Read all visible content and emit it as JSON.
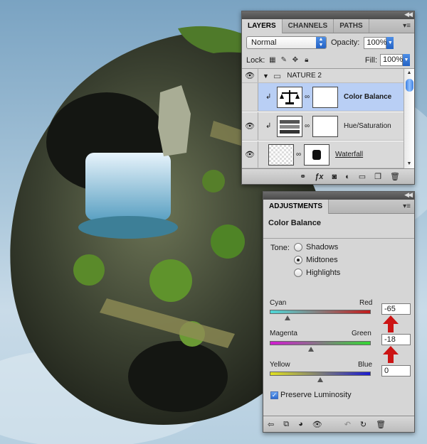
{
  "layers_panel": {
    "tabs": [
      {
        "label": "LAYERS",
        "active": true
      },
      {
        "label": "CHANNELS",
        "active": false
      },
      {
        "label": "PATHS",
        "active": false
      }
    ],
    "blend_mode": "Normal",
    "opacity_label": "Opacity:",
    "opacity_value": "100%",
    "lock_label": "Lock:",
    "fill_label": "Fill:",
    "fill_value": "100%",
    "layers": [
      {
        "name": "NATURE 2",
        "kind": "group"
      },
      {
        "name": "Color Balance",
        "kind": "adjustment",
        "selected": true
      },
      {
        "name": "Hue/Saturation",
        "kind": "adjustment"
      },
      {
        "name": "Waterfall",
        "kind": "smart"
      }
    ]
  },
  "adjustments_panel": {
    "tab": "ADJUSTMENTS",
    "title": "Color Balance",
    "tone_label": "Tone:",
    "tones": [
      {
        "label": "Shadows",
        "selected": false
      },
      {
        "label": "Midtones",
        "selected": true
      },
      {
        "label": "Highlights",
        "selected": false
      }
    ],
    "sliders": [
      {
        "left": "Cyan",
        "right": "Red",
        "value": "-65",
        "fraction": -0.65
      },
      {
        "left": "Magenta",
        "right": "Green",
        "value": "-18",
        "fraction": -0.18
      },
      {
        "left": "Yellow",
        "right": "Blue",
        "value": "0",
        "fraction": 0
      }
    ],
    "preserve_luminosity": "Preserve Luminosity"
  },
  "colors": {
    "selected_row": "#b9cff5",
    "arrow_red": "#cc1414",
    "accent_blue": "#2362c4"
  }
}
